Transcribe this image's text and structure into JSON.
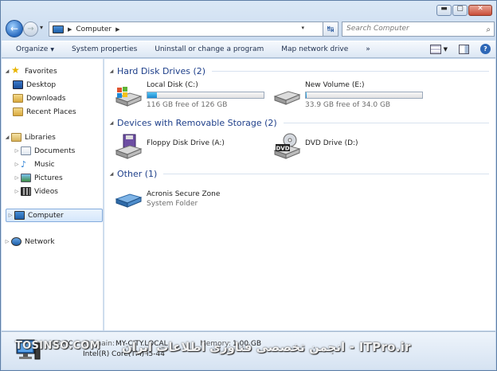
{
  "window": {
    "min_glyph": "▬",
    "max_glyph": "▢",
    "close_glyph": "✕"
  },
  "address": {
    "crumb": "Computer",
    "back_glyph": "←",
    "fwd_glyph": "→",
    "refresh_glyph": "↹"
  },
  "search": {
    "placeholder": "Search Computer",
    "glyph": "⌕"
  },
  "toolbar": {
    "organize": "Organize",
    "system_properties": "System properties",
    "uninstall": "Uninstall or change a program",
    "map_drive": "Map network drive",
    "more": "»",
    "help": "?"
  },
  "nav": {
    "favorites": "Favorites",
    "desktop": "Desktop",
    "downloads": "Downloads",
    "recent": "Recent Places",
    "libraries": "Libraries",
    "documents": "Documents",
    "music": "Music",
    "pictures": "Pictures",
    "videos": "Videos",
    "computer": "Computer",
    "network": "Network"
  },
  "groups": {
    "hdd": "Hard Disk Drives (2)",
    "removable": "Devices with Removable Storage (2)",
    "other": "Other (1)"
  },
  "drives": {
    "c": {
      "name": "Local Disk (C:)",
      "free": "116 GB free of 126 GB",
      "used_fraction": 0.08
    },
    "e": {
      "name": "New Volume (E:)",
      "free": "33.9 GB free of 34.0 GB",
      "used_fraction": 0.003
    },
    "a": {
      "name": "Floppy Disk Drive (A:)"
    },
    "d": {
      "name": "DVD Drive (D:)",
      "badge": "DVD"
    },
    "acronis": {
      "name": "Acronis Secure Zone",
      "sub": "System Folder"
    }
  },
  "details": {
    "pc_name": "PC-PC",
    "domain_label": "Domain:",
    "domain_value": "MY-CITY.LOCAL",
    "memory_label": "Memory:",
    "memory_value": "1.00 GB",
    "processor": "Intel(R) Core(TM) i5-44"
  },
  "watermark": {
    "left": "TOSINSO.COM",
    "right": "ITPro.ir - انجمن تخصصی فناوری اطلاعات ایران"
  },
  "colors": {
    "accent": "#1e3f8a",
    "selection": "#d5e7fb",
    "drive_bar": "#1a88cf"
  }
}
